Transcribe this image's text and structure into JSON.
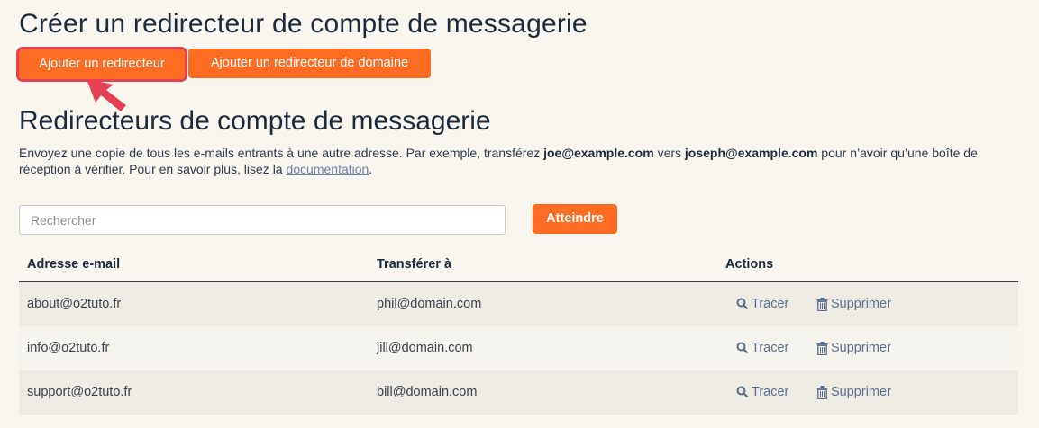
{
  "page": {
    "title": "Créer un redirecteur de compte de messagerie",
    "buttons": {
      "add_forwarder": "Ajouter un redirecteur",
      "add_domain_forwarder": "Ajouter un redirecteur de domaine"
    }
  },
  "section": {
    "title": "Redirecteurs de compte de messagerie",
    "desc_part1": "Envoyez une copie de tous les e-mails entrants à une autre adresse. Par exemple, transférez ",
    "desc_bold1": "joe@example.com",
    "desc_part2": " vers ",
    "desc_bold2": "joseph@example.com",
    "desc_part3": " pour n’avoir qu’une boîte de réception à vérifier. Pour en savoir plus, lisez la ",
    "desc_link": "documentation",
    "desc_end": "."
  },
  "search": {
    "placeholder": "Rechercher",
    "value": "",
    "go_label": "Atteindre"
  },
  "table": {
    "headers": {
      "email": "Adresse e-mail",
      "forward_to": "Transférer à",
      "actions": "Actions"
    },
    "rows": [
      {
        "email": "about@o2tuto.fr",
        "forward_to": "phil@domain.com",
        "trace": "Tracer",
        "delete": "Supprimer"
      },
      {
        "email": "info@o2tuto.fr",
        "forward_to": "jill@domain.com",
        "trace": "Tracer",
        "delete": "Supprimer"
      },
      {
        "email": "support@o2tuto.fr",
        "forward_to": "bill@domain.com",
        "trace": "Tracer",
        "delete": "Supprimer"
      }
    ]
  },
  "colors": {
    "accent": "#fd6c22",
    "highlight": "#e54053",
    "action_link": "#5b6f8a"
  },
  "icons": {
    "trace": "search-icon",
    "delete": "trash-icon",
    "annotation": "arrow-icon"
  }
}
